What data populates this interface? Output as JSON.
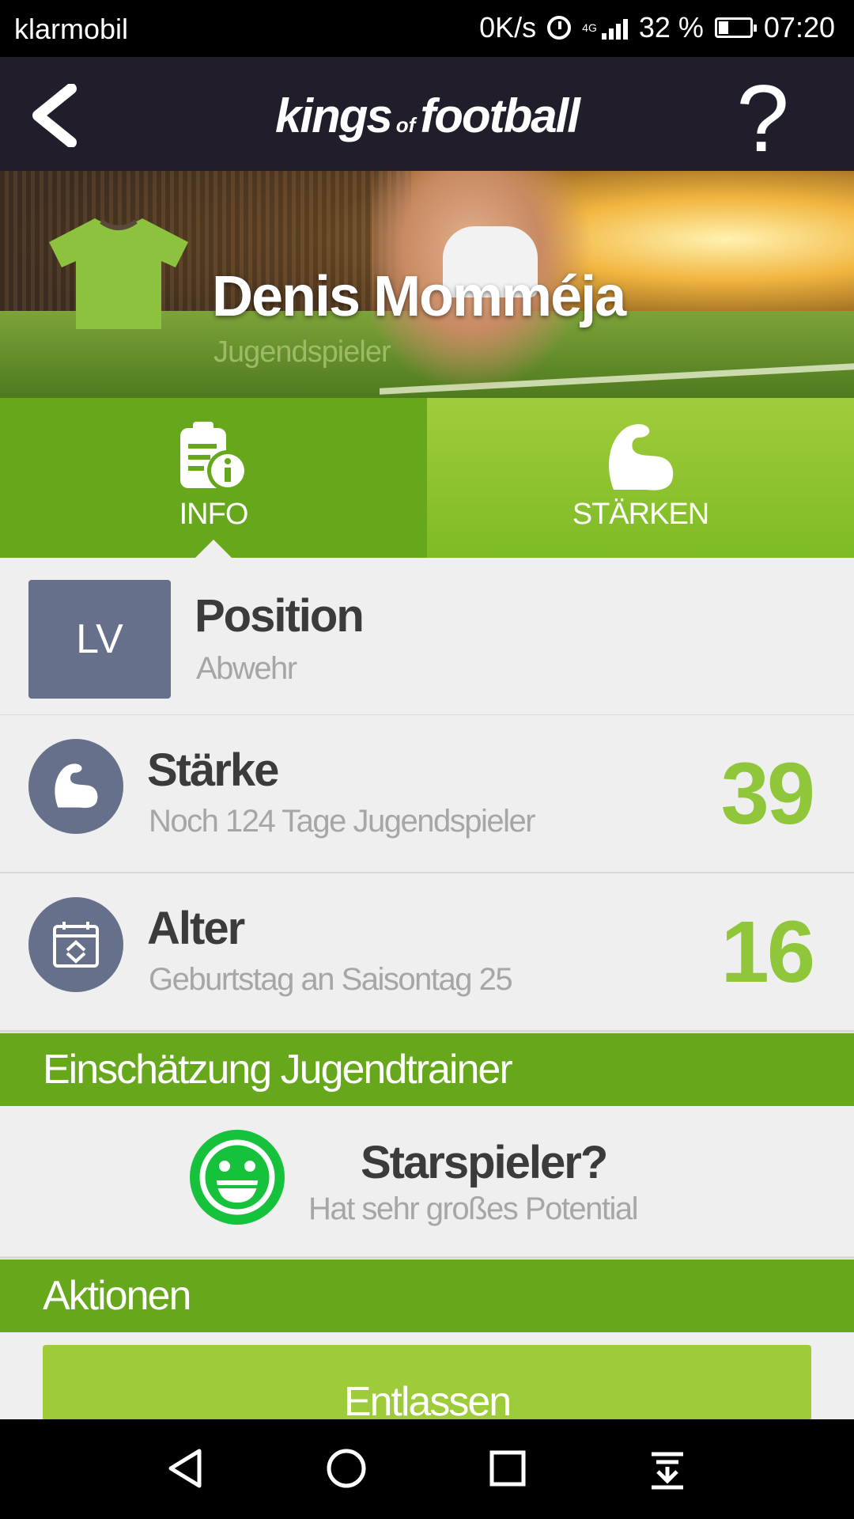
{
  "status_bar": {
    "carrier": "klarmobil",
    "net_speed": "0K/s",
    "network_type": "4G",
    "battery": "32 %",
    "time": "07:20"
  },
  "header": {
    "logo_main_left": "kings",
    "logo_small": "of",
    "logo_main_right": "football",
    "help_label": "?"
  },
  "player": {
    "name": "Denis Momméja",
    "role": "Jugendspieler",
    "shirt_color": "#8dc23f"
  },
  "tabs": [
    {
      "label": "INFO",
      "icon": "info-document-icon",
      "active": true
    },
    {
      "label": "STÄRKEN",
      "icon": "flexed-biceps-icon",
      "active": false
    }
  ],
  "position": {
    "code": "LV",
    "title": "Position",
    "subtitle": "Abwehr"
  },
  "staerke": {
    "title": "Stärke",
    "subtitle": "Noch 124 Tage Jugendspieler",
    "value": "39"
  },
  "alter": {
    "title": "Alter",
    "subtitle": "Geburtstag an Saisontag 25",
    "value": "16"
  },
  "assessment": {
    "section_title": "Einschätzung Jugendtrainer",
    "title": "Starspieler?",
    "subtitle": "Hat sehr großes Potential"
  },
  "actions": {
    "section_title": "Aktionen",
    "button_label": "Entlassen"
  },
  "colors": {
    "accent_green": "#66a71c",
    "value_green": "#8fc63a",
    "header_dark": "#221d2b",
    "icon_slate": "#66708a"
  }
}
